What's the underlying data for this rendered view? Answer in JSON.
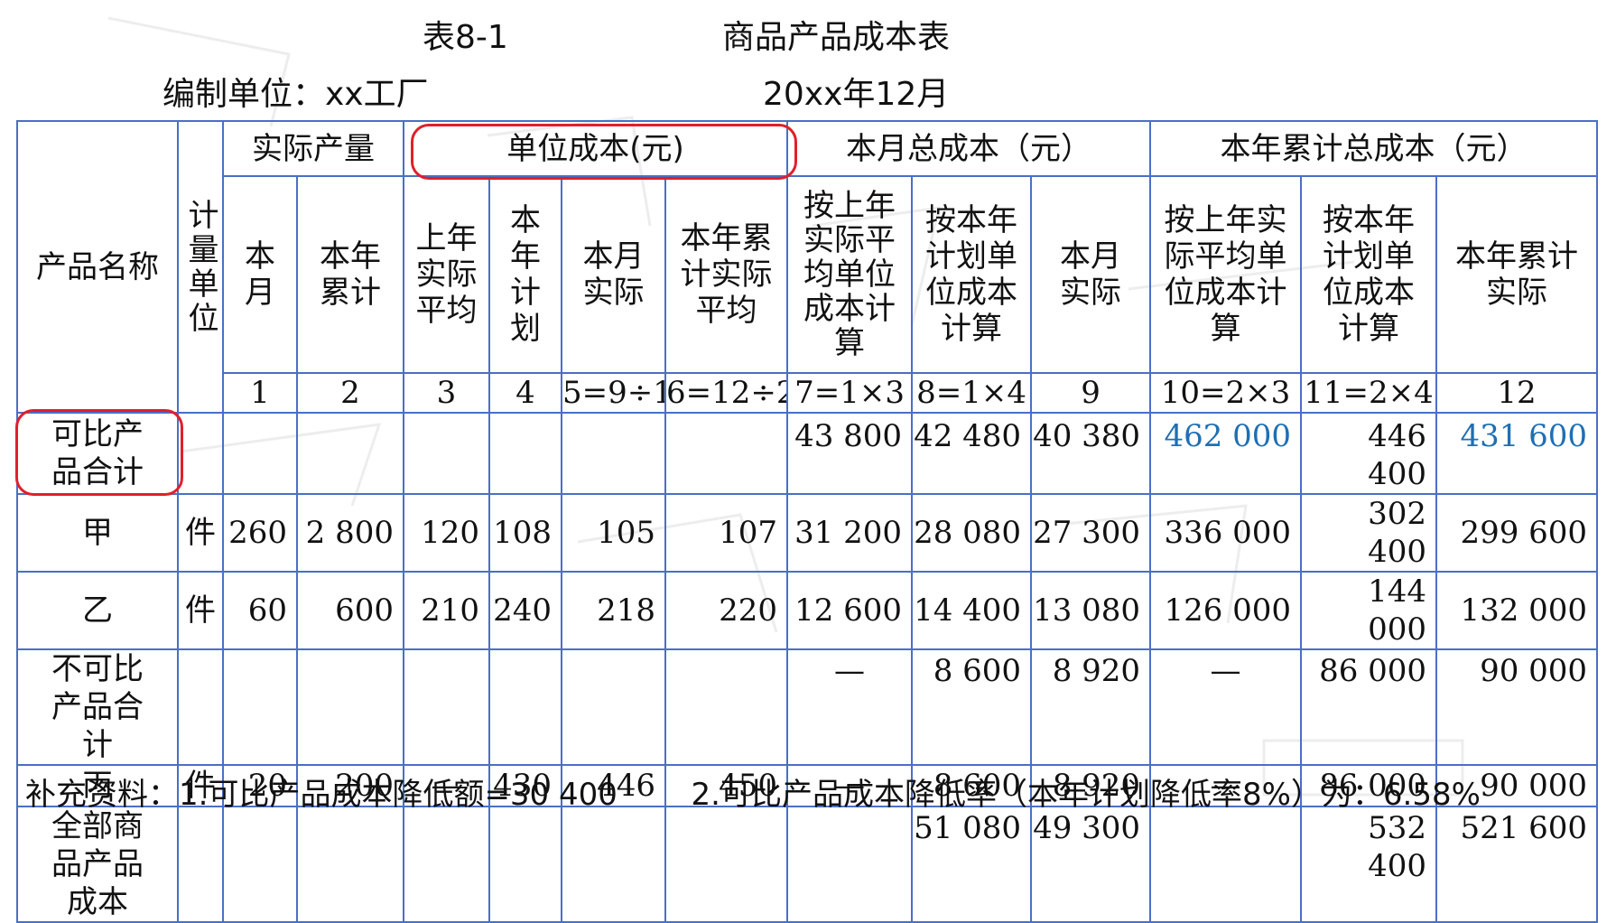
{
  "header": {
    "table_code": "表8-1",
    "title": "商品产品成本表",
    "unit_label": "编制单位：xx工厂",
    "date_label": "20xx年12月"
  },
  "table": {
    "col_product": "产品名称",
    "col_unit": "计量单位",
    "group_qty": "实际产量",
    "group_unit_cost": "单位成本(元)",
    "group_month_total": "本月总成本（元）",
    "group_year_total": "本年累计总成本（元）",
    "sub_headers": [
      "本月",
      "本年累计",
      "上年实际平均",
      "本年计划",
      "本月实际",
      "本年累计实际平均",
      "按上年实际平均单位成本计算",
      "按本年计划单位成本计算",
      "本月实际",
      "按上年实际平均单位成本计算",
      "按本年计划单位成本计算",
      "本年累计实际"
    ],
    "index_row": [
      "1",
      "2",
      "3",
      "4",
      "5=9÷1",
      "6=12÷2",
      "7=1×3",
      "8=1×4",
      "9",
      "10=2×3",
      "11=2×4",
      "12"
    ],
    "rows": [
      {
        "name": "可比产品合计",
        "unit": "",
        "cells": [
          "",
          "",
          "",
          "",
          "",
          "",
          "43 800",
          "42 480",
          "40 380",
          "462 000",
          "446 400",
          "431 600"
        ]
      },
      {
        "name": "甲",
        "unit": "件",
        "cells": [
          "260",
          "2 800",
          "120",
          "108",
          "105",
          "107",
          "31 200",
          "28 080",
          "27 300",
          "336 000",
          "302 400",
          "299 600"
        ]
      },
      {
        "name": "乙",
        "unit": "件",
        "cells": [
          "60",
          "600",
          "210",
          "240",
          "218",
          "220",
          "12 600",
          "14 400",
          "13 080",
          "126 000",
          "144 000",
          "132 000"
        ]
      },
      {
        "name": "不可比产品合计",
        "unit": "",
        "cells": [
          "",
          "",
          "",
          "",
          "",
          "",
          "—",
          "8 600",
          "8 920",
          "—",
          "86 000",
          "90 000"
        ]
      },
      {
        "name": "丙",
        "unit": "件",
        "cells": [
          "20",
          "200",
          "—",
          "430",
          "446",
          "450",
          "—",
          "8 600",
          "8 920",
          "—",
          "86 000",
          "90 000"
        ]
      },
      {
        "name": "全部商品产品成本",
        "unit": "",
        "cells": [
          "",
          "",
          "",
          "",
          "",
          "",
          "",
          "51 080",
          "49 300",
          "",
          "532 400",
          "521 600"
        ]
      }
    ]
  },
  "note": {
    "text1": "补充资料：1.可比产品成本降低额=30 400",
    "text2": "2.可比产品成本降低率（本年计划降低率8%）为：6.58%"
  },
  "colors": {
    "border": "#4a6fc7",
    "highlight": "#e0202a",
    "blue_value": "#1f6fb3"
  }
}
